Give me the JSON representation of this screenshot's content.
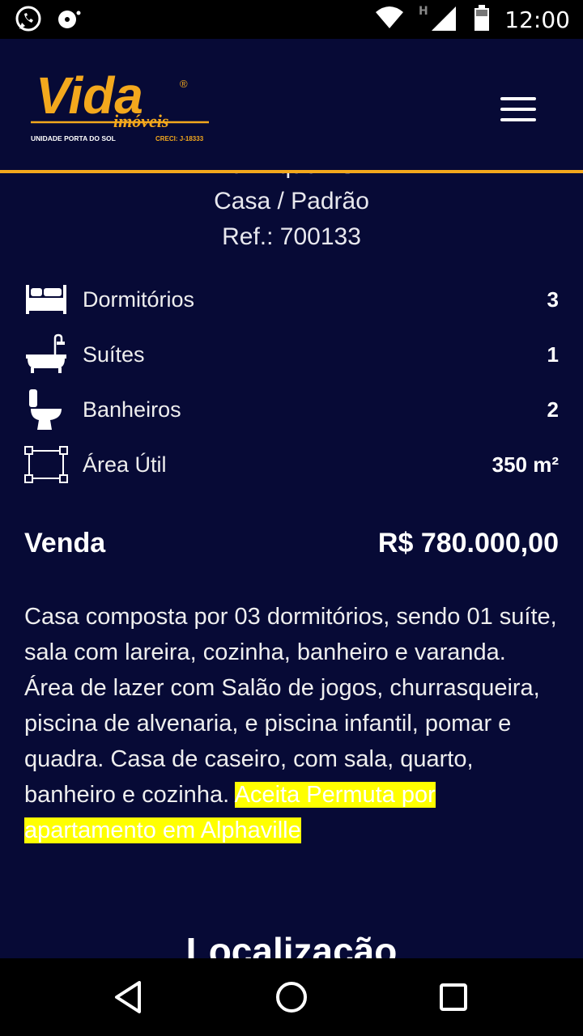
{
  "status_bar": {
    "time": "12:00",
    "icons": [
      "whatsapp-icon",
      "voicemail-icon",
      "wifi-icon",
      "signal-h-icon",
      "battery-icon"
    ]
  },
  "header": {
    "logo": {
      "brand": "Vida",
      "sub": "imóveis",
      "unit": "UNIDADE PORTA DO SOL",
      "creci": "CRECI: J-18333",
      "registered": "®"
    },
    "menu_icon": "hamburger-menu-icon"
  },
  "property": {
    "location": "Mairinque - SP",
    "type": "Casa / Padrão",
    "ref": "Ref.: 700133"
  },
  "features": [
    {
      "icon": "bed-icon",
      "label": "Dormitórios",
      "value": "3"
    },
    {
      "icon": "bathtub-icon",
      "label": "Suítes",
      "value": "1"
    },
    {
      "icon": "toilet-icon",
      "label": "Banheiros",
      "value": "2"
    },
    {
      "icon": "area-icon",
      "label": "Área Útil",
      "value": "350 m²"
    }
  ],
  "sale": {
    "label": "Venda",
    "price": "R$ 780.000,00"
  },
  "description": {
    "text": "Casa composta por 03 dormitórios, sendo 01 suíte, sala com lareira, cozinha, banheiro e varanda. Área de lazer com Salão de jogos, churrasqueira, piscina de alvenaria, e piscina infantil, pomar e quadra. Casa de caseiro, com sala, quarto, banheiro e cozinha. ",
    "highlight": "Aceita Permuta por apartamento em Alphaville"
  },
  "location_section": {
    "title": "Localização"
  },
  "colors": {
    "background": "#070a36",
    "accent": "#f3a81d",
    "highlight": "#ffff00"
  }
}
